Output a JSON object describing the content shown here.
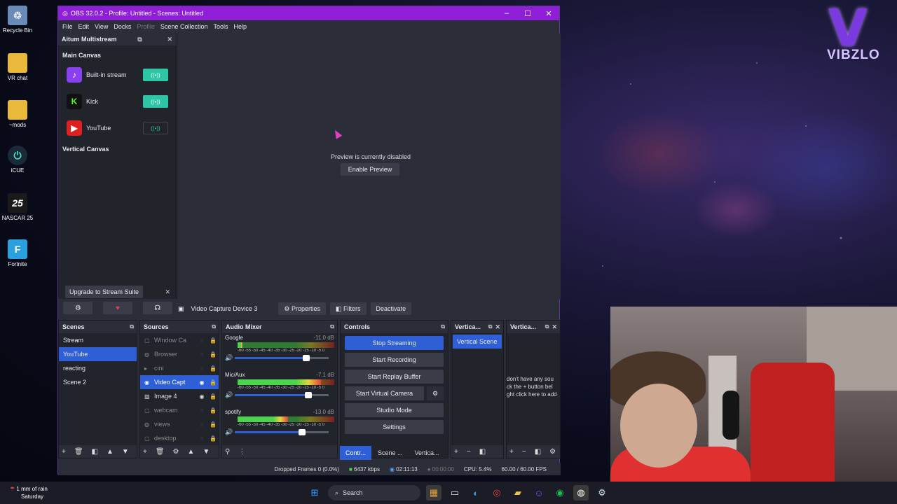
{
  "desktop": {
    "icons": [
      {
        "label": "Recycle Bin",
        "icon": "recycle-bin-icon",
        "color": "#6a8ab8"
      },
      {
        "label": "VR chat",
        "icon": "folder-icon",
        "color": "#e9b93a"
      },
      {
        "label": "~mods",
        "icon": "folder-icon",
        "color": "#e9b93a"
      },
      {
        "label": "iCUE",
        "icon": "icue-icon",
        "color": "#1b2a38"
      },
      {
        "label": "NASCAR 25",
        "icon": "nascar-icon",
        "color": "#1a1a1a"
      },
      {
        "label": "Fortnite",
        "icon": "fortnite-icon",
        "color": "#2aa0e0"
      }
    ],
    "logo_text": "VIBZLO",
    "logo_glyph": "V"
  },
  "obs": {
    "title": "OBS 32.0.2 - Profile: Untitled - Scenes: Untitled",
    "menu": [
      "File",
      "Edit",
      "View",
      "Docks",
      "Profile",
      "Scene Collection",
      "Tools",
      "Help"
    ],
    "multistream": {
      "title": "Aitum Multistream",
      "main_canvas": "Main Canvas",
      "vertical_canvas": "Vertical Canvas",
      "services": [
        {
          "name": "Built-in stream",
          "color": "#8a3ff0",
          "glyph": "♪",
          "active": true
        },
        {
          "name": "Kick",
          "color": "#111111",
          "glyph": "K",
          "active": true
        },
        {
          "name": "YouTube",
          "color": "#e02020",
          "glyph": "▶",
          "active": false
        }
      ],
      "upgrade": "Upgrade to Stream Suite",
      "upgrade_close": "✕"
    },
    "preview": {
      "message": "Preview is currently disabled",
      "button": "Enable Preview"
    },
    "source_bar": {
      "source": "Video Capture Device 3",
      "properties": "Properties",
      "filters": "Filters",
      "deactivate": "Deactivate"
    },
    "scenes": {
      "title": "Scenes",
      "items": [
        "Stream",
        "YouTube",
        "reacting",
        "Scene 2"
      ],
      "selected": 1
    },
    "sources": {
      "title": "Sources",
      "items": [
        {
          "name": "Window Ca",
          "icon": "▢"
        },
        {
          "name": "Browser",
          "icon": "◍"
        },
        {
          "name": "cini",
          "icon": "▸"
        },
        {
          "name": "Video Capt",
          "icon": "◉"
        },
        {
          "name": "Image 4",
          "icon": "▨"
        },
        {
          "name": "webcam",
          "icon": "▢"
        },
        {
          "name": "views",
          "icon": "◍"
        },
        {
          "name": "desktop",
          "icon": "▢"
        }
      ],
      "selected": 3
    },
    "mixer": {
      "title": "Audio Mixer",
      "scale": "-60 -55 -50 -45 -40 -35 -30 -25 -20 -15 -10 -5 0",
      "channels": [
        {
          "name": "Google",
          "db": "-11.0 dB",
          "level": 0.05,
          "volume": 0.76
        },
        {
          "name": "Mic/Aux",
          "db": "-7.1 dB",
          "level": 0.86,
          "volume": 0.78
        },
        {
          "name": "spotify",
          "db": "-13.0 dB",
          "level": 0.52,
          "volume": 0.72
        }
      ]
    },
    "controls": {
      "title": "Controls",
      "stop_streaming": "Stop Streaming",
      "start_recording": "Start Recording",
      "start_replay": "Start Replay Buffer",
      "start_virtual": "Start Virtual Camera",
      "studio_mode": "Studio Mode",
      "settings": "Settings"
    },
    "vertical_scenes": {
      "title": "Vertica...",
      "item": "Vertical Scene"
    },
    "vertical_sources": {
      "title": "Vertica...",
      "text": [
        "don't have any sou",
        "ck the + button bel",
        "ght click here to add"
      ]
    },
    "tabs": [
      "Contr...",
      "Scene ...",
      "Vertica..."
    ],
    "status": {
      "dropped": "Dropped Frames 0 (0.0%)",
      "bitrate": "6437 kbps",
      "stream_time": "02:11:13",
      "rec_time": "00:00:00",
      "cpu": "CPU: 5.4%",
      "fps": "60.00 / 60.00 FPS"
    }
  },
  "taskbar": {
    "weather_line1": "1 mm of rain",
    "weather_line2": "Saturday",
    "search": "Search"
  }
}
